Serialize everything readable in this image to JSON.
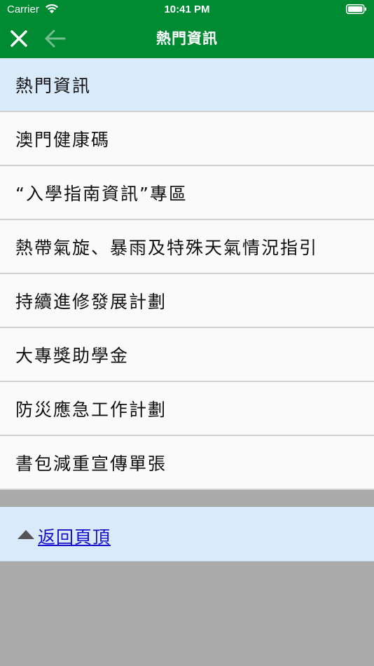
{
  "status_bar": {
    "carrier": "Carrier",
    "time": "10:41 PM"
  },
  "nav": {
    "title": "熱門資訊",
    "close_icon": "close-icon",
    "back_icon": "arrow-left-icon"
  },
  "list": {
    "items": [
      {
        "label": "熱門資訊",
        "selected": true
      },
      {
        "label": "澳門健康碼",
        "selected": false
      },
      {
        "label": "“入學指南資訊”專區",
        "selected": false
      },
      {
        "label": "熱帶氣旋、暴雨及特殊天氣情況指引",
        "selected": false
      },
      {
        "label": "持續進修發展計劃",
        "selected": false
      },
      {
        "label": "大專獎助學金",
        "selected": false
      },
      {
        "label": "防災應急工作計劃",
        "selected": false
      },
      {
        "label": "書包減重宣傳單張",
        "selected": false
      }
    ]
  },
  "footer": {
    "back_to_top_label": "返回頁頂",
    "icon": "triangle-up-icon"
  },
  "colors": {
    "header_bg": "#008a32",
    "selected_bg": "#d9eafb",
    "item_bg": "#fafafa",
    "page_bg": "#aaaaaa",
    "link": "#1a0dcc"
  }
}
